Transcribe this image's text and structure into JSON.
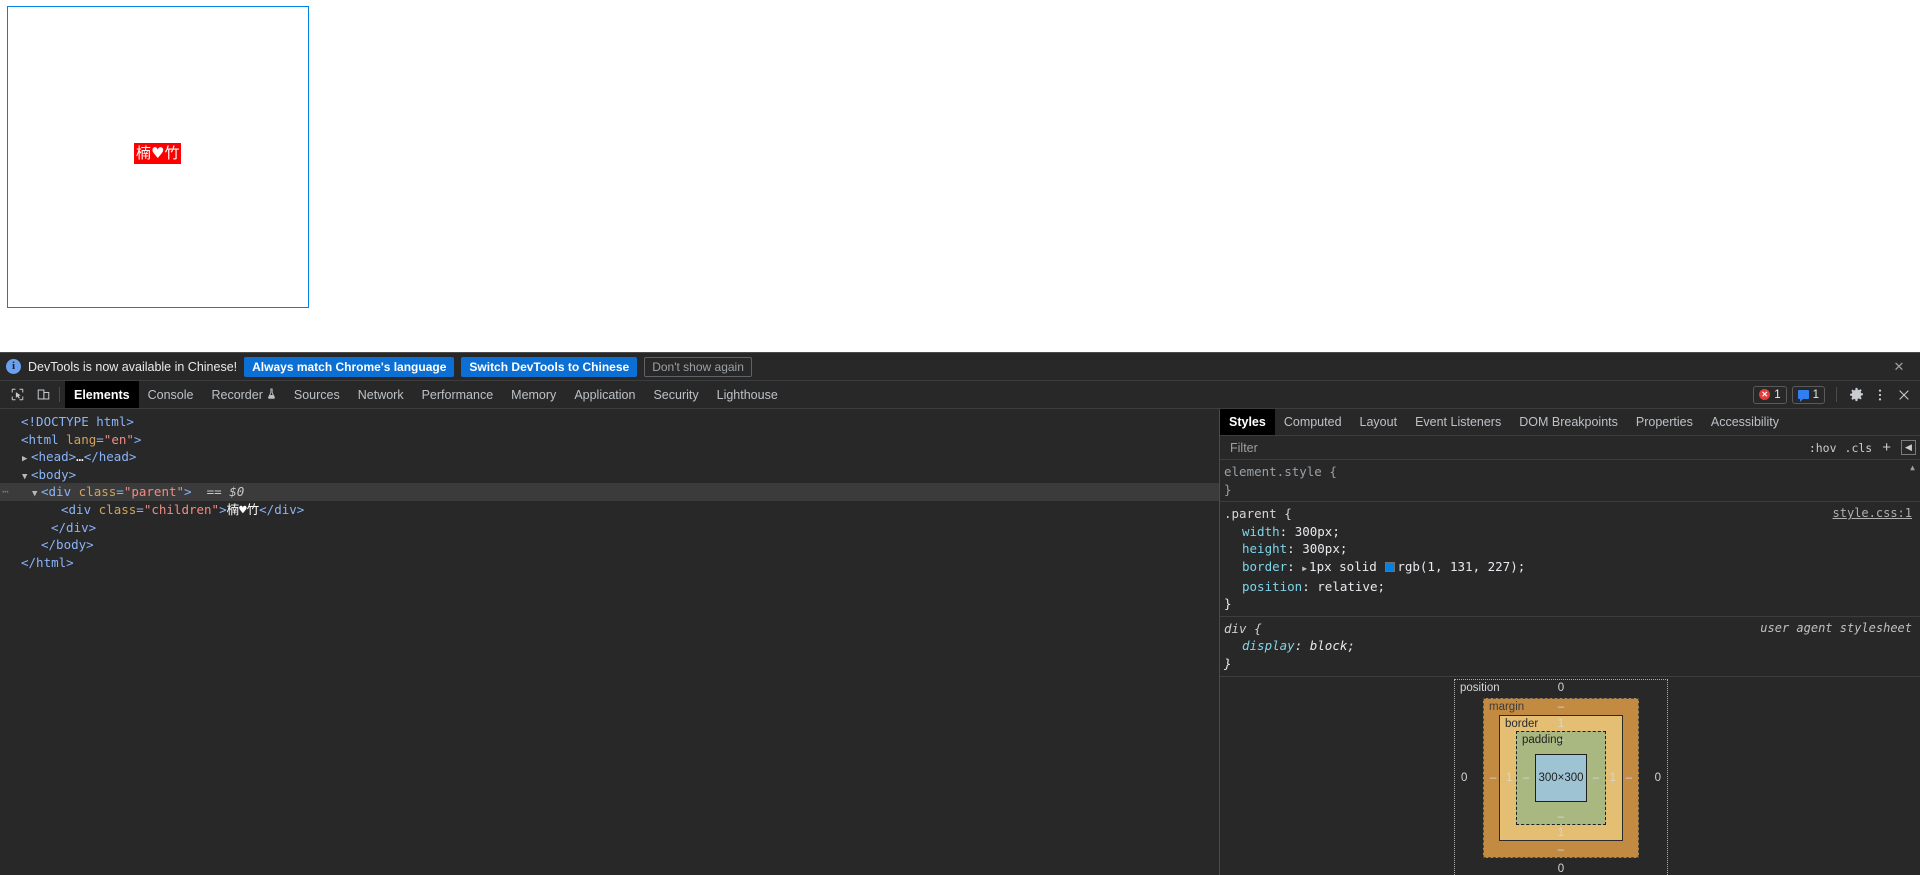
{
  "page": {
    "parent_class": "parent",
    "children_class": "children",
    "children_text": "楠♥竹"
  },
  "infobar": {
    "icon": "info-icon",
    "message": "DevTools is now available in Chinese!",
    "buttons": [
      {
        "label": "Always match Chrome's language",
        "style": "primary"
      },
      {
        "label": "Switch DevTools to Chinese",
        "style": "primary"
      },
      {
        "label": "Don't show again",
        "style": "ghost"
      }
    ],
    "close": "✕"
  },
  "tabbar": {
    "left_icons": [
      "inspect-element-icon",
      "device-toolbar-icon"
    ],
    "tabs": [
      {
        "label": "Elements",
        "active": true
      },
      {
        "label": "Console",
        "active": false
      },
      {
        "label": "Recorder",
        "active": false,
        "icon": "flask-icon"
      },
      {
        "label": "Sources",
        "active": false
      },
      {
        "label": "Network",
        "active": false
      },
      {
        "label": "Performance",
        "active": false
      },
      {
        "label": "Memory",
        "active": false
      },
      {
        "label": "Application",
        "active": false
      },
      {
        "label": "Security",
        "active": false
      },
      {
        "label": "Lighthouse",
        "active": false
      }
    ],
    "error_count": "1",
    "message_count": "1",
    "settings_icon": "gear-icon",
    "more_icon": "kebab-menu-icon",
    "close_icon": "close-icon"
  },
  "dom_tree": [
    {
      "indent": 0,
      "arrow": "",
      "html": "<span class=\"tag\">&lt;!DOCTYPE html&gt;</span>",
      "selected": false
    },
    {
      "indent": 0,
      "arrow": "",
      "html": "<span class=\"tag\">&lt;html </span><span class=\"attr\">lang</span><span class=\"tag\">=</span><span class=\"val\">\"en\"</span><span class=\"tag\">&gt;</span>",
      "selected": false
    },
    {
      "indent": 1,
      "arrow": "▶",
      "html": "<span class=\"tag\">&lt;head&gt;</span><span class=\"txt\">…</span><span class=\"tag\">&lt;/head&gt;</span>",
      "selected": false
    },
    {
      "indent": 1,
      "arrow": "▼",
      "html": "<span class=\"tag\">&lt;body&gt;</span>",
      "selected": false
    },
    {
      "indent": 2,
      "arrow": "▼",
      "html": "<span class=\"tag\">&lt;div </span><span class=\"attr\">class</span><span class=\"tag\">=</span><span class=\"val\">\"parent\"</span><span class=\"tag\">&gt;</span><span class=\"eq\">  == </span><span class=\"dollar\">$0</span>",
      "selected": true
    },
    {
      "indent": 4,
      "arrow": "",
      "html": "<span class=\"tag\">&lt;div </span><span class=\"attr\">class</span><span class=\"tag\">=</span><span class=\"val\">\"children\"</span><span class=\"tag\">&gt;</span><span class=\"txt\">楠♥竹</span><span class=\"tag\">&lt;/div&gt;</span>",
      "selected": false
    },
    {
      "indent": 3,
      "arrow": "",
      "html": "<span class=\"tag\">&lt;/div&gt;</span>",
      "selected": false
    },
    {
      "indent": 2,
      "arrow": "",
      "html": "<span class=\"tag\">&lt;/body&gt;</span>",
      "selected": false
    },
    {
      "indent": 0,
      "arrow": "",
      "html": "<span class=\"tag\">&lt;/html&gt;</span>",
      "selected": false
    }
  ],
  "styles": {
    "tabs": [
      {
        "label": "Styles",
        "active": true
      },
      {
        "label": "Computed",
        "active": false
      },
      {
        "label": "Layout",
        "active": false
      },
      {
        "label": "Event Listeners",
        "active": false
      },
      {
        "label": "DOM Breakpoints",
        "active": false
      },
      {
        "label": "Properties",
        "active": false
      },
      {
        "label": "Accessibility",
        "active": false
      }
    ],
    "filter_placeholder": "Filter",
    "filter_value": "",
    "toolbar": {
      "hov": ":hov",
      "cls": ".cls",
      "new_rule": "+",
      "sidebar_toggle": "◀"
    },
    "rules": [
      {
        "selector": "element.style {",
        "close": "}",
        "origin": "",
        "origin_link": false,
        "muted": true,
        "ua": false,
        "declarations": []
      },
      {
        "selector": ".parent {",
        "close": "}",
        "origin": "style.css:1",
        "origin_link": true,
        "muted": false,
        "ua": false,
        "declarations": [
          {
            "prop": "width",
            "value": "300px;",
            "swatch": false,
            "triangle": false
          },
          {
            "prop": "height",
            "value": "300px;",
            "swatch": false,
            "triangle": false
          },
          {
            "prop": "border",
            "value": "1px solid rgb(1, 131, 227);",
            "swatch": true,
            "triangle": true,
            "swatch_color": "#0183e3"
          },
          {
            "prop": "position",
            "value": "relative;",
            "swatch": false,
            "triangle": false
          }
        ]
      },
      {
        "selector": "div {",
        "close": "}",
        "origin": "user agent stylesheet",
        "origin_link": false,
        "muted": false,
        "ua": true,
        "declarations": [
          {
            "prop": "display",
            "value": "block;",
            "swatch": false,
            "triangle": false
          }
        ]
      }
    ]
  },
  "box_model": {
    "position_label": "position",
    "position_top": "0",
    "position_bottom": "0",
    "position_left": "0",
    "position_right": "0",
    "margin_label": "margin",
    "margin_top": "–",
    "margin_bottom": "–",
    "margin_left": "–",
    "margin_right": "–",
    "border_label": "border",
    "border_top": "1",
    "border_bottom": "1",
    "border_left": "1",
    "border_right": "1",
    "padding_label": "padding",
    "padding_top": "–",
    "padding_bottom": "–",
    "padding_left": "–",
    "padding_right": "–",
    "content_size": "300×300"
  }
}
